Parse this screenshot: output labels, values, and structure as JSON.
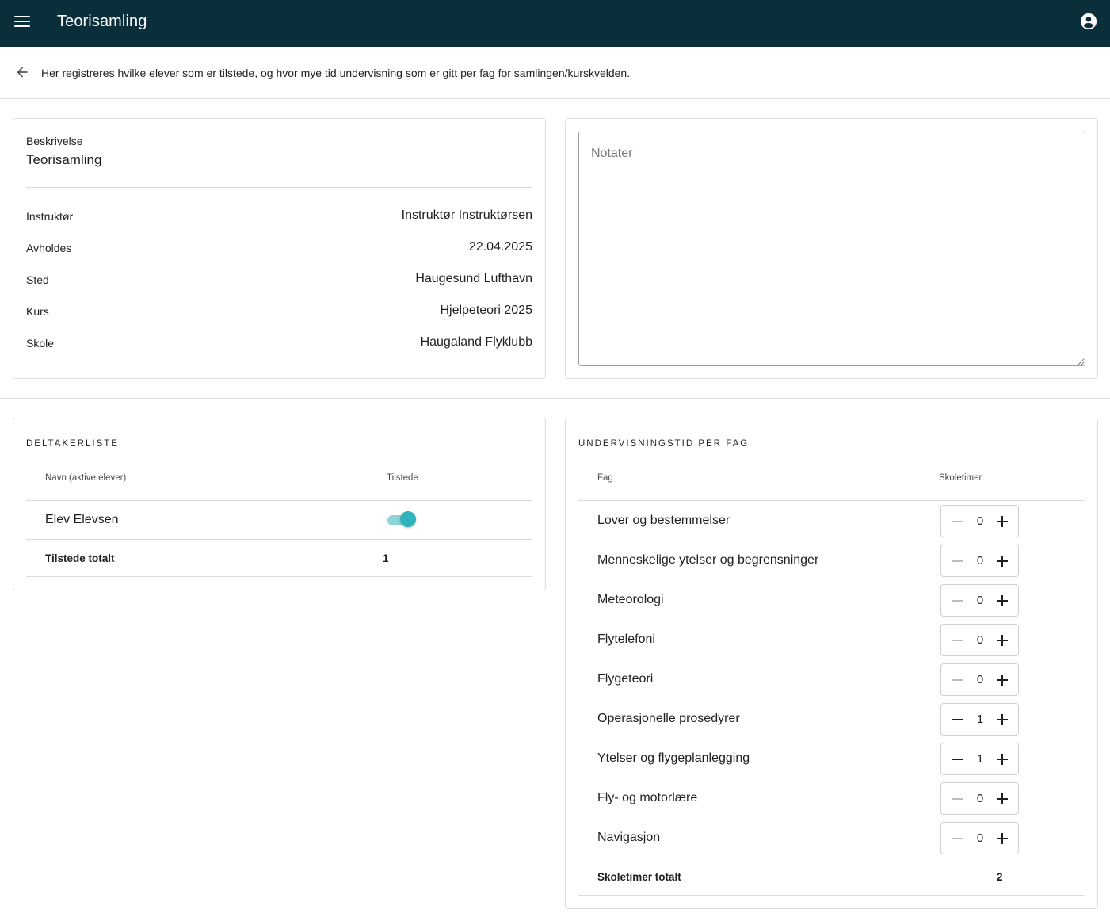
{
  "appbar": {
    "title": "Teorisamling",
    "menu_icon": "menu-icon",
    "account_icon": "account-circle-icon"
  },
  "subheader": {
    "back_icon": "arrow-back-icon",
    "text": "Her registreres hvilke elever som er tilstede, og hvor mye tid undervisning som er gitt per fag for samlingen/kurskvelden."
  },
  "description": {
    "label": "Beskrivelse",
    "value": "Teorisamling",
    "rows": [
      {
        "label": "Instruktør",
        "value": "Instruktør Instruktørsen"
      },
      {
        "label": "Avholdes",
        "value": "22.04.2025"
      },
      {
        "label": "Sted",
        "value": "Haugesund Lufthavn"
      },
      {
        "label": "Kurs",
        "value": "Hjelpeteori 2025"
      },
      {
        "label": "Skole",
        "value": "Haugaland Flyklubb"
      }
    ]
  },
  "notes": {
    "placeholder": "Notater",
    "value": ""
  },
  "participants": {
    "title": "DELTAKERLISTE",
    "col_name": "Navn (aktive elever)",
    "col_present": "Tilstede",
    "rows": [
      {
        "name": "Elev Elevsen",
        "present": true
      }
    ],
    "total_label": "Tilstede totalt",
    "total_value": "1"
  },
  "subjects": {
    "title": "UNDERVISNINGSTID PER FAG",
    "col_subject": "Fag",
    "col_hours": "Skoletimer",
    "rows": [
      {
        "name": "Lover og bestemmelser",
        "hours": "0"
      },
      {
        "name": "Menneskelige ytelser og begrensninger",
        "hours": "0"
      },
      {
        "name": "Meteorologi",
        "hours": "0"
      },
      {
        "name": "Flytelefoni",
        "hours": "0"
      },
      {
        "name": "Flygeteori",
        "hours": "0"
      },
      {
        "name": "Operasjonelle prosedyrer",
        "hours": "1"
      },
      {
        "name": "Ytelser og flygeplanlegging",
        "hours": "1"
      },
      {
        "name": "Fly- og motorlære",
        "hours": "0"
      },
      {
        "name": "Navigasjon",
        "hours": "0"
      }
    ],
    "total_label": "Skoletimer totalt",
    "total_value": "2"
  },
  "colors": {
    "appbar_bg": "#0b2e3b",
    "toggle_on": "#2fb3bd"
  }
}
